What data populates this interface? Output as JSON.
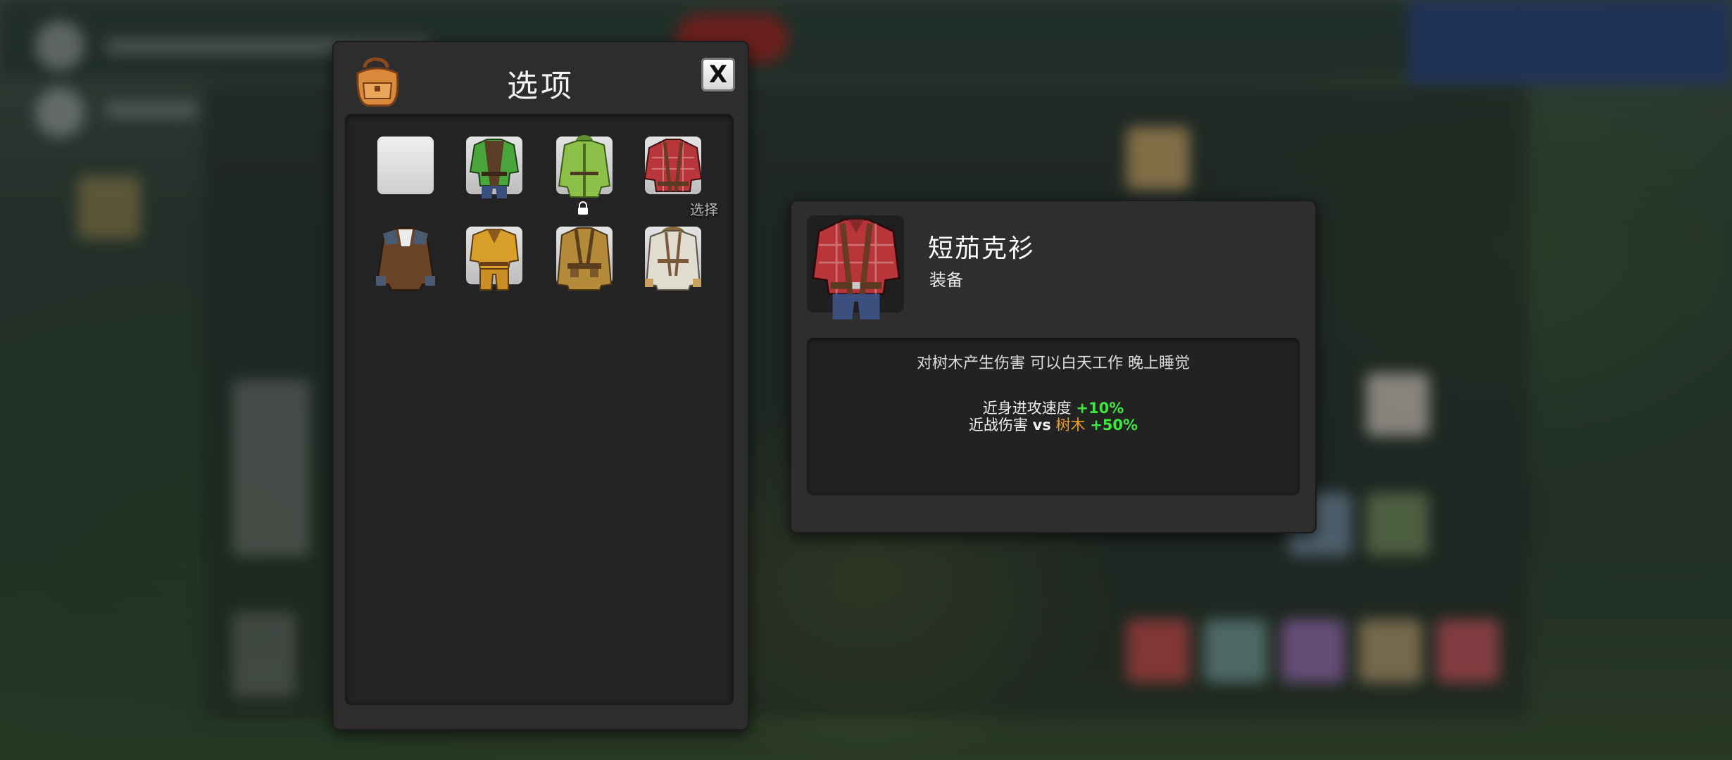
{
  "options_panel": {
    "title": "选项",
    "close_label": "X",
    "select_label": "选择",
    "items": [
      {
        "name": "empty-slot",
        "colors": {
          "body": "#e6e6e6"
        }
      },
      {
        "name": "green-vest",
        "colors": {
          "body": "#4caf3c",
          "accent": "#6b4b2e"
        }
      },
      {
        "name": "green-jacket",
        "colors": {
          "body": "#8fc24a",
          "accent": "#5b7b2e"
        }
      },
      {
        "name": "plaid-shirt",
        "colors": {
          "body": "#b8353a",
          "accent": "#6b3a22"
        }
      },
      {
        "name": "leather-coat",
        "colors": {
          "body": "#6a4428",
          "accent": "#4a5a70"
        }
      },
      {
        "name": "yellow-outfit",
        "colors": {
          "body": "#d8a02a",
          "accent": "#8a5a1e"
        }
      },
      {
        "name": "khaki-jacket",
        "colors": {
          "body": "#b48a3a",
          "accent": "#5a3e1e"
        }
      },
      {
        "name": "white-coat",
        "colors": {
          "body": "#e0dcd0",
          "accent": "#7a5a3a"
        }
      }
    ]
  },
  "detail": {
    "name": "短茄克衫",
    "type": "装备",
    "description": "对树木产生伤害 可以白天工作 晚上睡觉",
    "stats": [
      {
        "label": "近身进攻速度",
        "value": "+10%"
      },
      {
        "label": "近战伤害",
        "vs": "vs",
        "target": "树木",
        "value": "+50%"
      }
    ]
  },
  "colors": {
    "positive": "#3ee83e",
    "target": "#f0a020",
    "panel": "#2d2d2d"
  }
}
